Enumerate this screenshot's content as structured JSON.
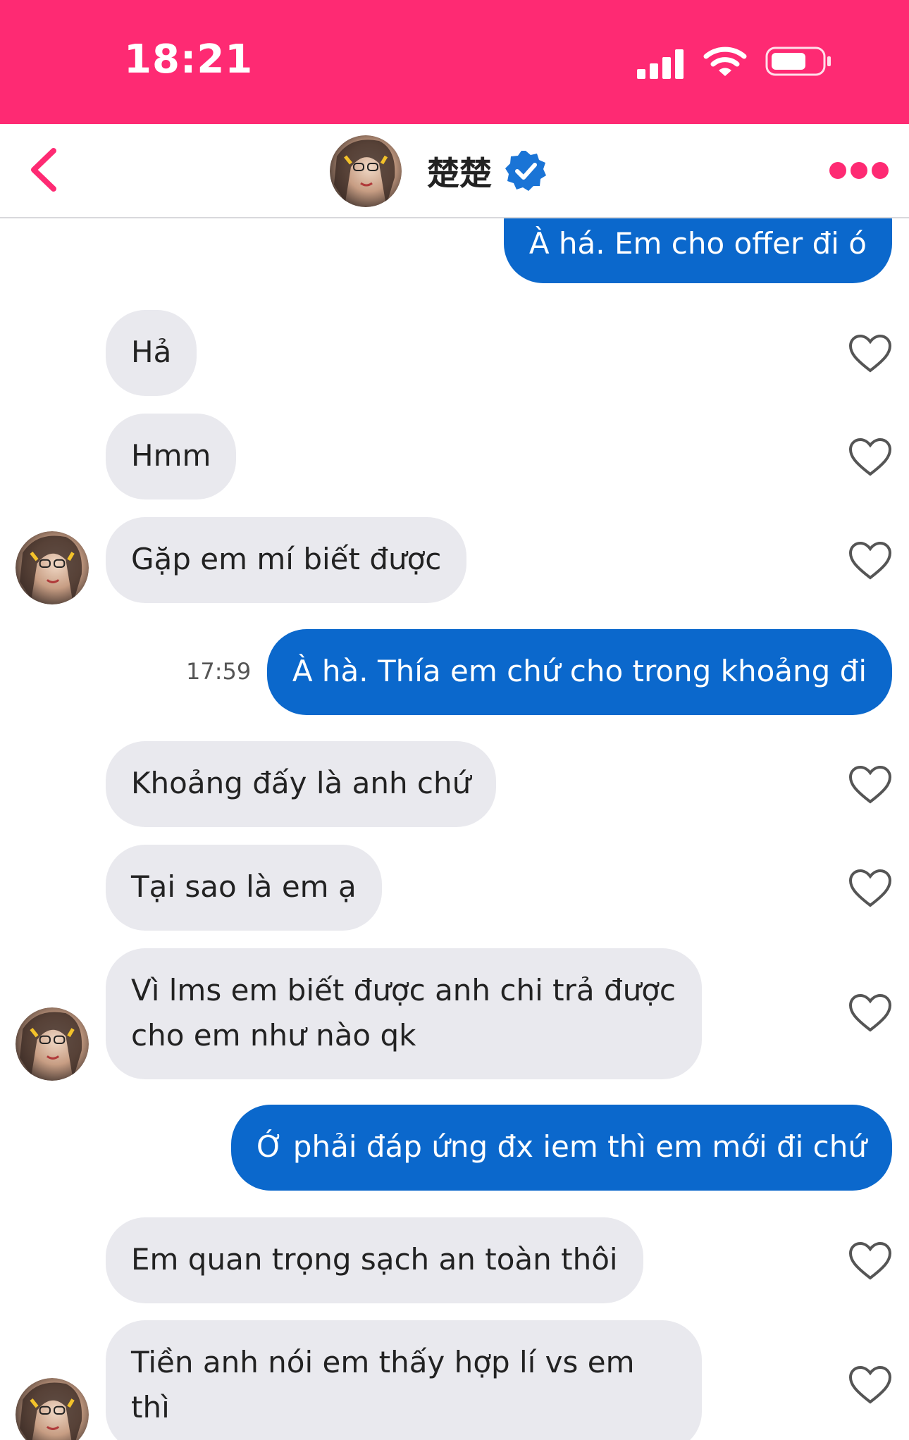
{
  "status_bar": {
    "time": "18:21",
    "background": "#fe2a73"
  },
  "header": {
    "contact_name": "楚楚",
    "verified": true,
    "back_icon": "chevron-left-icon",
    "more_icon": "more-dots-icon",
    "accent": "#fe2a73"
  },
  "messages": [
    {
      "direction": "out",
      "text": "À há. Em cho offer đi ó"
    },
    {
      "direction": "in",
      "text": "Hả",
      "liked": false
    },
    {
      "direction": "in",
      "text": "Hmm",
      "liked": false
    },
    {
      "direction": "in",
      "text": "Gặp em mí biết được",
      "liked": false
    },
    {
      "direction": "out",
      "text": "À hà. Thía em chứ cho trong khoảng đi",
      "time": "17:59"
    },
    {
      "direction": "in",
      "text": "Khoảng đấy là anh chứ",
      "liked": false
    },
    {
      "direction": "in",
      "text": "Tại sao là em ạ",
      "liked": false
    },
    {
      "direction": "in",
      "text": "Vì lms em biết được anh chi trả được\ncho em như nào qk",
      "liked": false
    },
    {
      "direction": "out",
      "text": "Ớ phải đáp ứng đx iem thì em mới đi chứ"
    },
    {
      "direction": "in",
      "text": "Em quan trọng sạch an toàn thôi",
      "liked": false
    },
    {
      "direction": "in",
      "text": "Tiền anh nói em thấy hợp lí vs em thì\nem oki",
      "liked": false
    }
  ],
  "colors": {
    "incoming_bubble": "#e9e9ee",
    "outgoing_bubble": "#0b68cc"
  }
}
